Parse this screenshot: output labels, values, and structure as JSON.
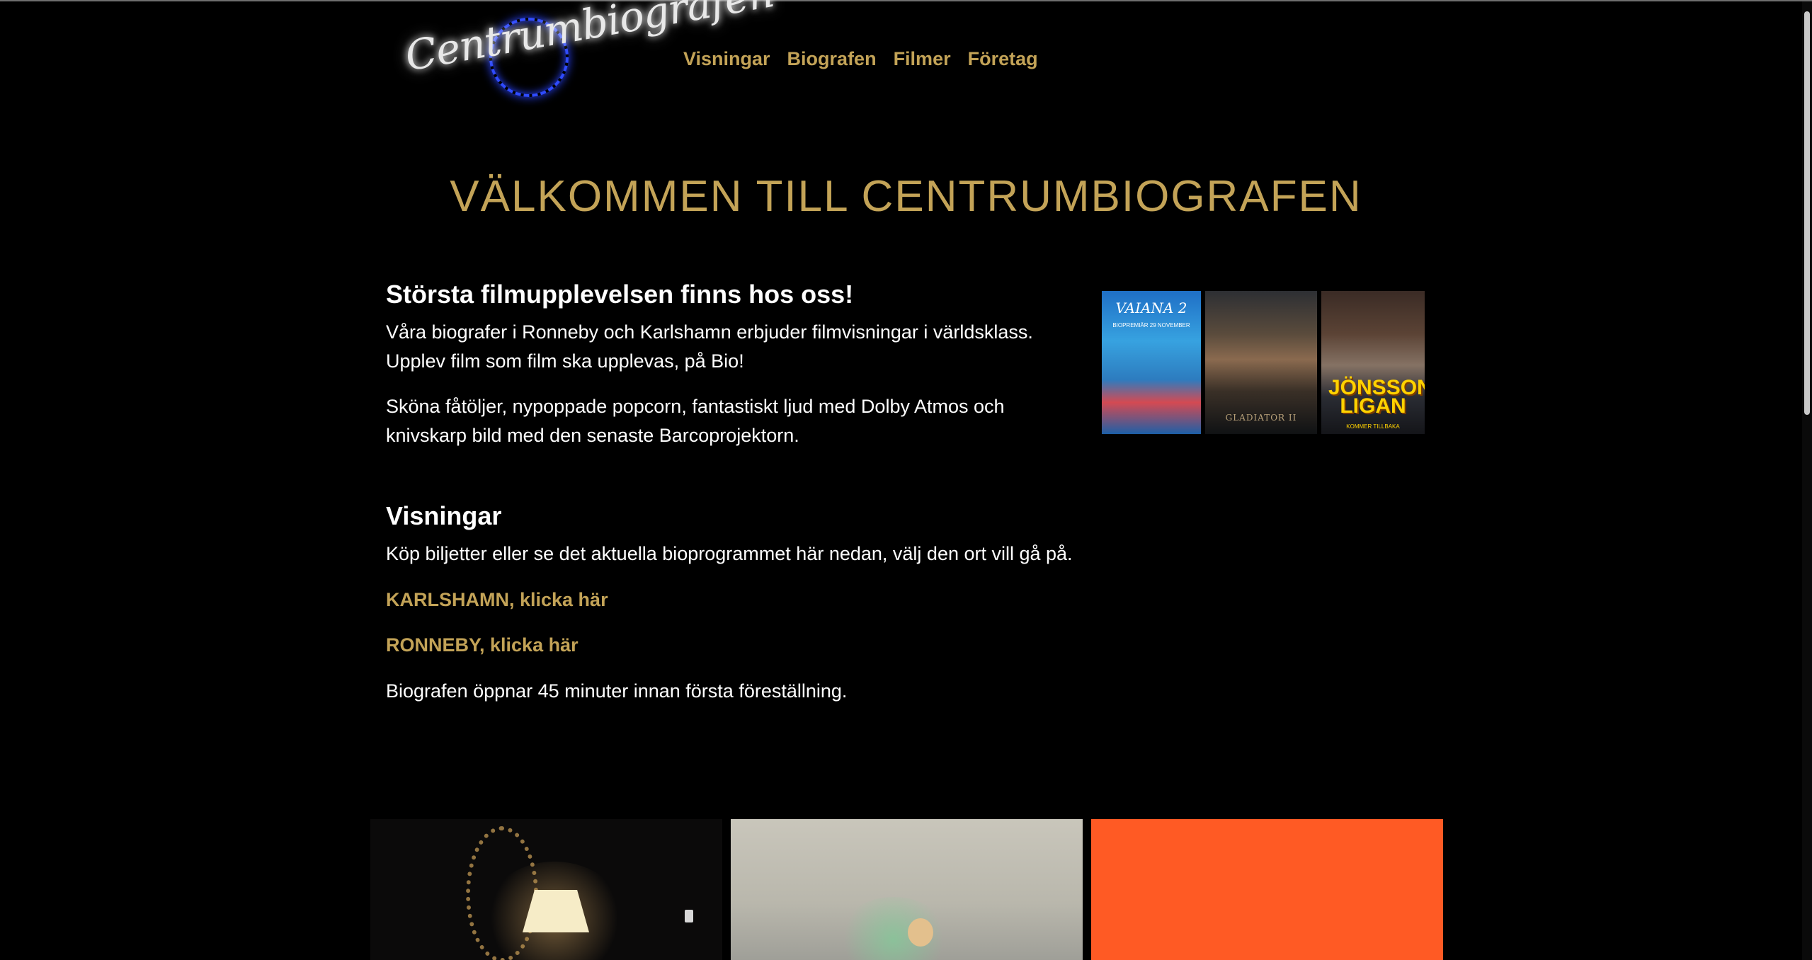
{
  "header": {
    "logo_text": "Centrumbiografen",
    "nav": [
      "Visningar",
      "Biografen",
      "Filmer",
      "Företag"
    ]
  },
  "hero": {
    "title": "VÄLKOMMEN TILL CENTRUMBIOGRAFEN"
  },
  "intro": {
    "heading": "Största filmupplevelsen finns hos oss!",
    "paragraph1_line1": "Våra biografer i Ronneby och Karlshamn erbjuder filmvisningar i världsklass.",
    "paragraph1_line2": "Upplev film som film ska upplevas, på Bio!",
    "paragraph2_line1": "Sköna fåtöljer, nypoppade popcorn, fantastiskt ljud med Dolby Atmos och",
    "paragraph2_line2": "knivskarp bild med den senaste Barcoprojektorn."
  },
  "posters": [
    {
      "title": "VAIANA 2",
      "subtitle": "BIOPREMIÄR 29 NOVEMBER"
    },
    {
      "title": "GLADIATOR II"
    },
    {
      "title_line1": "JÖNSSON",
      "title_line2": "LIGAN",
      "subtitle": "KOMMER TILLBAKA"
    }
  ],
  "visningar": {
    "heading": "Visningar",
    "text": "Köp biljetter eller se det aktuella bioprogrammet här nedan, välj den ort vill gå på.",
    "link_karlshamn": "KARLSHAMN, klicka här",
    "link_ronneby": "RONNEBY, klicka här",
    "note": "Biografen öppnar 45 minuter innan första föreställning."
  },
  "colors": {
    "accent_gold": "#c3a357",
    "background": "#000000",
    "tile_orange": "#ff5a24",
    "logo_neon_blue": "#2f4bff"
  }
}
